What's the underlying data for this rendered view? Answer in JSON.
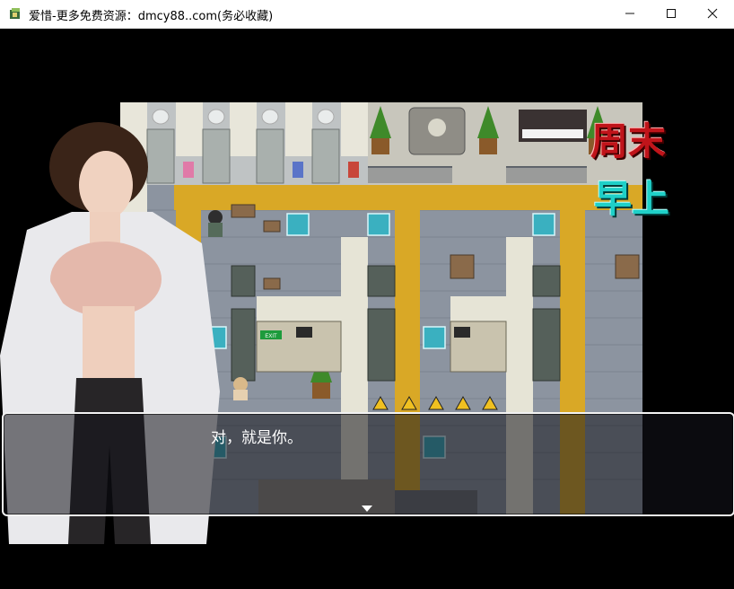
{
  "window": {
    "title": "爱惜-更多免费资源：dmcy88..com(务必收藏)",
    "icon": "game-app-icon",
    "controls": [
      "minimize-icon",
      "maximize-icon",
      "close-icon"
    ]
  },
  "hud": {
    "day_label": "周末",
    "time_label": "早上"
  },
  "map_signs": {
    "exit_sign": "EXIT"
  },
  "dialogue": {
    "text": "对，就是你。",
    "continue_indicator": "down-triangle-icon"
  },
  "colors": {
    "day_label": "#c0141a",
    "time_label": "#1fd0c8",
    "message_border": "#f2f2f2",
    "tactile_paving": "#d9a826"
  }
}
